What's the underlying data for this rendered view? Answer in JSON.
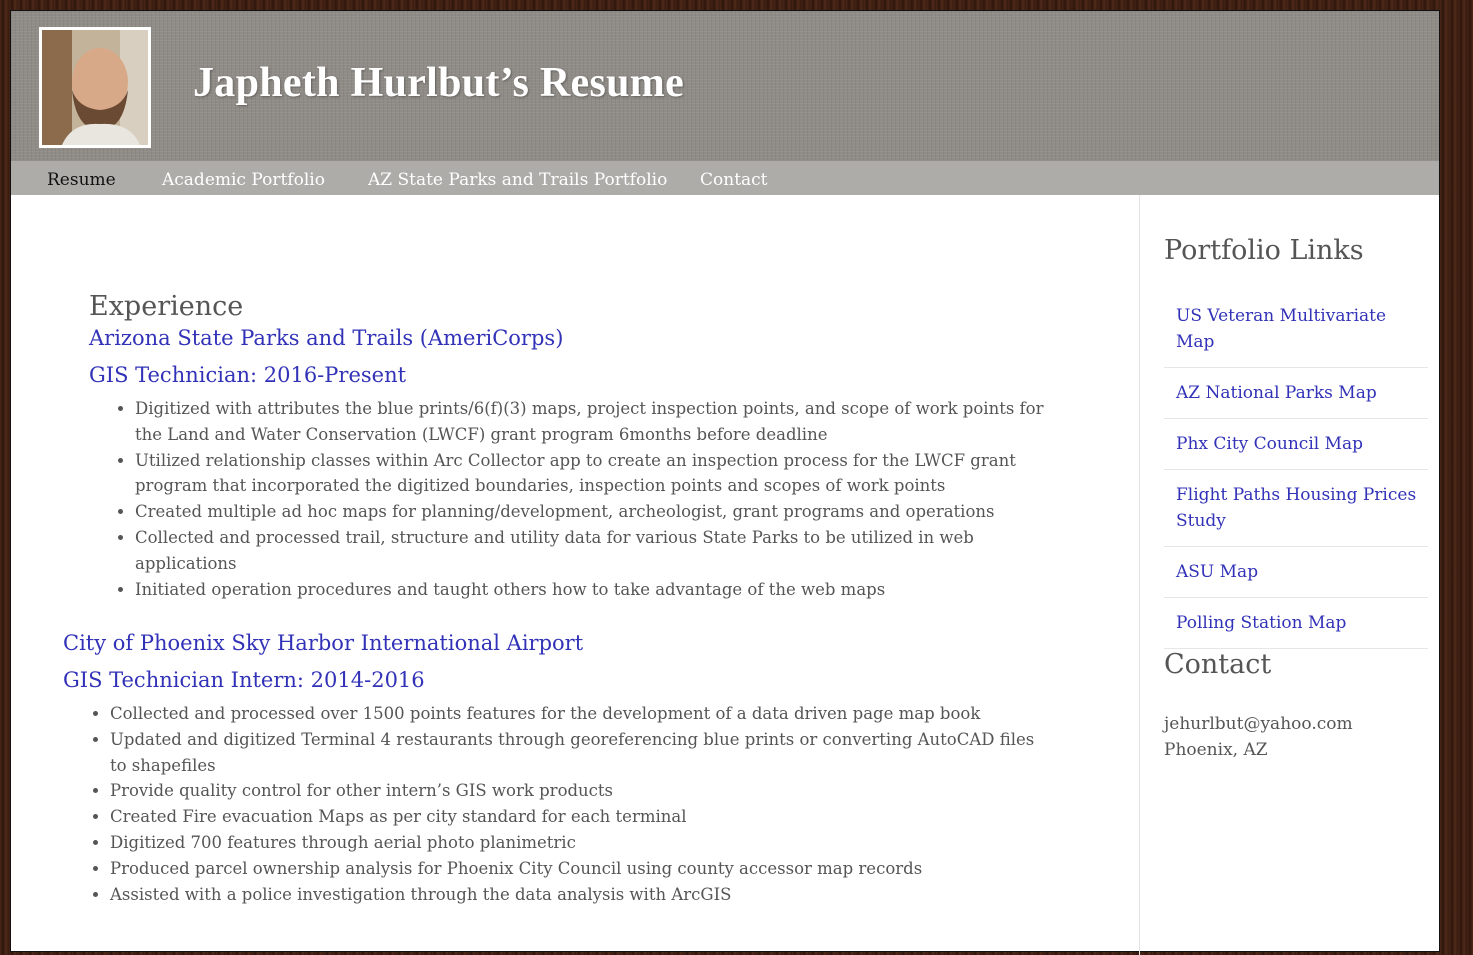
{
  "header": {
    "title": "Japheth Hurlbut’s Resume"
  },
  "nav": {
    "items": [
      {
        "label": "Resume"
      },
      {
        "label": "Academic Portfolio"
      },
      {
        "label": "AZ State Parks and Trails Portfolio"
      },
      {
        "label": "Contact"
      }
    ]
  },
  "main": {
    "section_heading": "Experience",
    "jobs": [
      {
        "org": "Arizona State Parks and Trails (AmeriCorps)",
        "title": "GIS Technician: 2016-Present",
        "bullets": [
          "Digitized with attributes the blue prints/6(f)(3) maps, project inspection points, and scope of work points for the Land and Water Conservation (LWCF) grant program 6months before deadline",
          "Utilized relationship classes within Arc Collector app to create an inspection process for the LWCF grant program that incorporated the digitized boundaries, inspection points and scopes of work points",
          "Created multiple ad hoc maps for planning/development, archeologist, grant programs and operations",
          "Collected and processed trail, structure and utility data for various State Parks to be utilized in web applications",
          "Initiated operation procedures and taught others how to take advantage of the web maps"
        ]
      },
      {
        "org": "City of Phoenix Sky Harbor International Airport",
        "title": "GIS Technician Intern: 2014-2016",
        "bullets": [
          "Collected and processed over 1500 points features for the development of a data driven page map book",
          "Updated and digitized Terminal 4 restaurants through georeferencing blue prints or converting AutoCAD files to shapefiles",
          "Provide quality control for other intern’s GIS work products",
          "Created Fire evacuation Maps as per city standard for each terminal",
          "Digitized 700 features through aerial photo planimetric",
          "Produced parcel ownership analysis for Phoenix City Council using county accessor map records",
          "Assisted with a police investigation through the data analysis with ArcGIS"
        ]
      }
    ]
  },
  "sidebar": {
    "portfolio_heading": "Portfolio Links",
    "links": [
      {
        "label": "US Veteran Multivariate Map"
      },
      {
        "label": "AZ National Parks Map"
      },
      {
        "label": "Phx City Council Map"
      },
      {
        "label": "Flight Paths Housing Prices Study"
      },
      {
        "label": "ASU Map"
      },
      {
        "label": "Polling Station Map"
      }
    ],
    "contact_heading": "Contact",
    "email": "jehurlbut@yahoo.com",
    "location": "Phoenix, AZ"
  },
  "colors": {
    "link": "#3232b8",
    "header_bg": "#8f8b86",
    "nav_bg": "#aeaca8",
    "text": "#555555"
  }
}
